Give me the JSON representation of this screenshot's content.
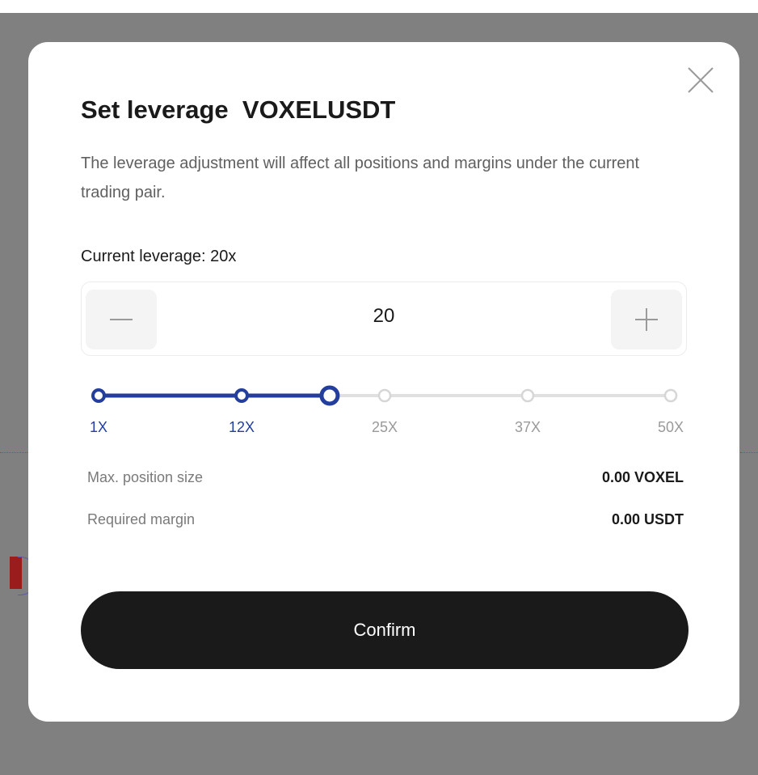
{
  "dialog": {
    "title": "Set leverage  VOXELUSDT",
    "description": "The leverage adjustment will affect all positions and margins under the current trading pair.",
    "current_leverage": "Current leverage: 20x",
    "close_icon": "close-icon"
  },
  "stepper": {
    "value": "20",
    "minus_icon": "minus-icon",
    "plus_icon": "plus-icon"
  },
  "slider": {
    "min": 1,
    "max": 50,
    "current": 20,
    "ticks": [
      {
        "label": "1X",
        "value": 1
      },
      {
        "label": "12X",
        "value": 12
      },
      {
        "label": "25X",
        "value": 25
      },
      {
        "label": "37X",
        "value": 37
      },
      {
        "label": "50X",
        "value": 50
      }
    ]
  },
  "info": {
    "max_position_label": "Max. position size",
    "max_position_value": "0.00 VOXEL",
    "required_margin_label": "Required margin",
    "required_margin_value": "0.00 USDT"
  },
  "confirm_label": "Confirm",
  "colors": {
    "accent": "#233e9b",
    "inactive_track": "#e0e0e0",
    "button_dark": "#1a1a1a",
    "backdrop": "#808080"
  }
}
